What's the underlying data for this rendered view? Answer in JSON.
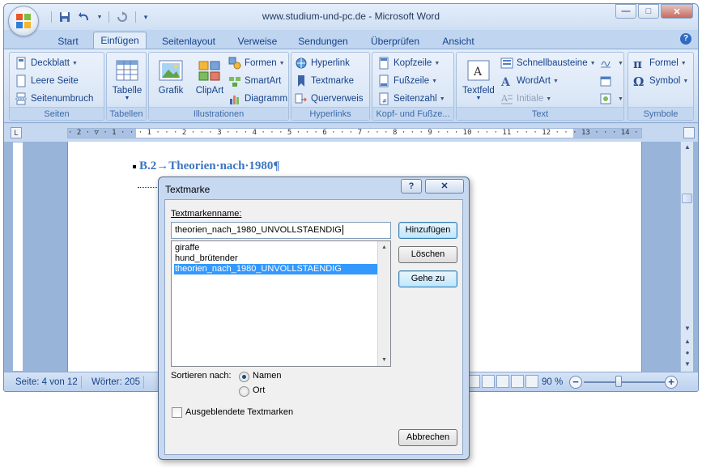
{
  "window": {
    "title": "www.studium-und-pc.de - Microsoft Word",
    "min_glyph": "—",
    "max_glyph": "□",
    "close_glyph": "✕"
  },
  "tabs": [
    {
      "label": "Start"
    },
    {
      "label": "Einfügen",
      "active": true
    },
    {
      "label": "Seitenlayout"
    },
    {
      "label": "Verweise"
    },
    {
      "label": "Sendungen"
    },
    {
      "label": "Überprüfen"
    },
    {
      "label": "Ansicht"
    }
  ],
  "ribbon": {
    "seiten": {
      "label": "Seiten",
      "deckblatt": "Deckblatt",
      "leere_seite": "Leere Seite",
      "seitenumbruch": "Seitenumbruch"
    },
    "tabellen": {
      "label": "Tabellen",
      "tabelle": "Tabelle"
    },
    "illustrationen": {
      "label": "Illustrationen",
      "grafik": "Grafik",
      "clipart": "ClipArt",
      "formen": "Formen",
      "smartart": "SmartArt",
      "diagramm": "Diagramm"
    },
    "hyperlinks": {
      "label": "Hyperlinks",
      "hyperlink": "Hyperlink",
      "textmarke": "Textmarke",
      "querverweis": "Querverweis"
    },
    "kopf_fuss": {
      "label": "Kopf- und Fußze...",
      "kopfzeile": "Kopfzeile",
      "fusszeile": "Fußzeile",
      "seitenzahl": "Seitenzahl"
    },
    "text": {
      "label": "Text",
      "textfeld": "Textfeld",
      "schnellbausteine": "Schnellbausteine",
      "wordart": "WordArt",
      "initiale": "Initiale"
    },
    "symbole": {
      "label": "Symbole",
      "formel": "Formel",
      "symbol": "Symbol"
    }
  },
  "ruler": {
    "corner": "L",
    "text": "· 2 · ▽ · 1 · · · 1 · · · 2 · · · 3 · · · 4 · · · 5 · · · 6 · · · 7 · · · 8 · · · 9 · · · 10 · · · 11 · · · 12 · · · 13 · · · 14 · · · 15 · · · 16 · △ · · 18 ·"
  },
  "document": {
    "heading": "B.2→Theorien·nach·1980¶"
  },
  "statusbar": {
    "page": "Seite: 4 von 12",
    "words": "Wörter: 205",
    "zoom": "90 %"
  },
  "dialog": {
    "title": "Textmarke",
    "help": "?",
    "close": "✕",
    "name_label": "Textmarkenname:",
    "name_value": "theorien_nach_1980_UNVOLLSTAENDIG",
    "items": [
      {
        "label": "giraffe",
        "selected": false
      },
      {
        "label": "hund_brütender",
        "selected": false
      },
      {
        "label": "theorien_nach_1980_UNVOLLSTAENDIG",
        "selected": true
      }
    ],
    "buttons": {
      "add": "Hinzufügen",
      "delete": "Löschen",
      "goto": "Gehe zu",
      "cancel": "Abbrechen"
    },
    "sort_label": "Sortieren nach:",
    "sort_options": [
      {
        "label": "Namen",
        "checked": true
      },
      {
        "label": "Ort",
        "checked": false
      }
    ],
    "hidden_label": "Ausgeblendete Textmarken",
    "hidden_checked": false
  },
  "colors": {
    "accent": "#15428b",
    "ribbon_bg": "#dbe7f6",
    "selection": "#3399ff",
    "heading": "#3b76c2"
  }
}
